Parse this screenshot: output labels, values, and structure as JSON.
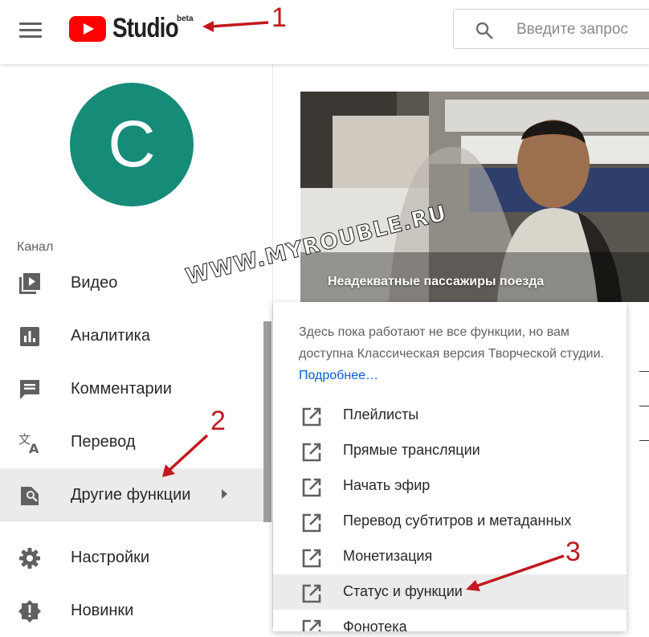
{
  "header": {
    "brand_word": "Studio",
    "brand_tag": "beta",
    "search_placeholder": "Введите запрос"
  },
  "sidebar": {
    "avatar_letter": "C",
    "avatar_color": "#168b78",
    "section_label": "Канал",
    "items": [
      {
        "label": "Видео",
        "icon": "video-library-icon"
      },
      {
        "label": "Аналитика",
        "icon": "analytics-icon"
      },
      {
        "label": "Комментарии",
        "icon": "comments-icon"
      },
      {
        "label": "Перевод",
        "icon": "translate-icon"
      },
      {
        "label": "Другие функции",
        "icon": "other-features-icon",
        "active": true,
        "has_submenu": true
      }
    ],
    "bottom_items": [
      {
        "label": "Настройки",
        "icon": "settings-icon"
      },
      {
        "label": "Новинки",
        "icon": "whats-new-icon"
      }
    ]
  },
  "video": {
    "title": "Неадекватные пассажиры поезда"
  },
  "popup": {
    "note": "Здесь пока работают не все функции, но вам доступна Классическая версия Творческой студии.",
    "link": "Подробнее…",
    "items": [
      {
        "label": "Плейлисты"
      },
      {
        "label": "Прямые трансляции"
      },
      {
        "label": "Начать эфир"
      },
      {
        "label": "Перевод субтитров и метаданных"
      },
      {
        "label": "Монетизация"
      },
      {
        "label": "Статус и функции",
        "active": true
      },
      {
        "label": "Фонотека"
      }
    ]
  },
  "watermark": "WWW.MYROUBLE.RU",
  "annotations": [
    "1",
    "2",
    "3"
  ],
  "colors": {
    "brand_red": "#ff0000",
    "annotation_red": "#c0191f",
    "link_blue": "#065fd4"
  }
}
